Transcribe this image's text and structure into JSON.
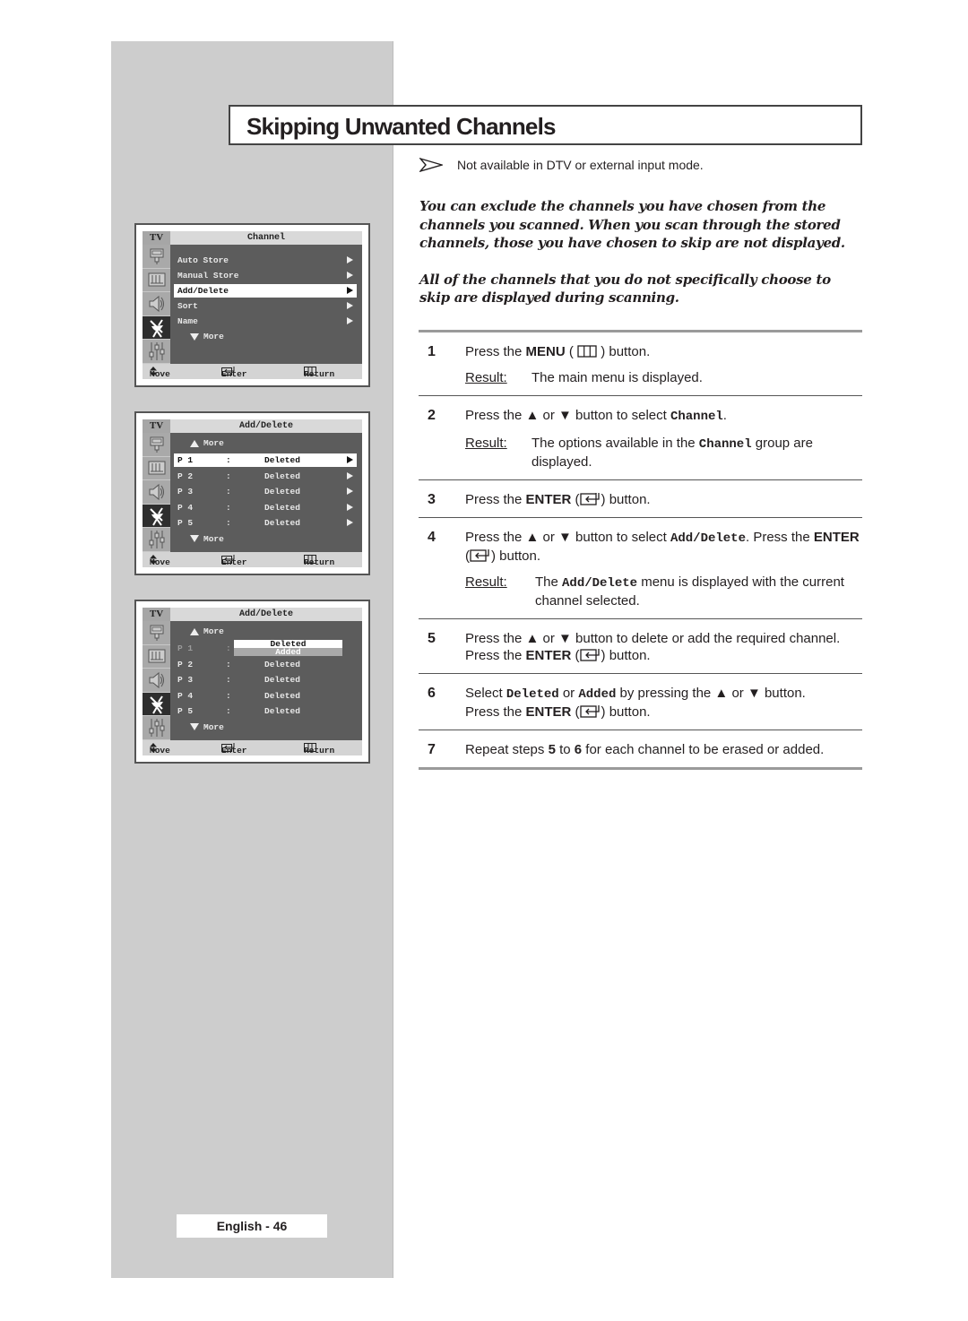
{
  "page": {
    "title": "Skipping Unwanted Channels",
    "note": "Not available in DTV or external input mode.",
    "note_icon": "arrow-pointer-icon",
    "intro": [
      "You can exclude the channels you have chosen from the channels you scanned. When you scan through the stored channels, those you have chosen to skip are not displayed.",
      "All of the channels that you do not specifically choose to skip are displayed during scanning."
    ],
    "page_number": "English - 46"
  },
  "steps": [
    {
      "num": "1",
      "parts": {
        "a": "Press the ",
        "b": "MENU",
        "c": " ( ",
        "d": " )  button."
      },
      "result_label": "Result:",
      "result": "The main menu is displayed."
    },
    {
      "num": "2",
      "parts": {
        "a": "Press the ▲ or ▼ button to select ",
        "mono": "Channel",
        "c": "."
      },
      "result_label": "Result:",
      "result_a": "The options available in the ",
      "result_mono": "Channel",
      "result_b": " group are displayed."
    },
    {
      "num": "3",
      "parts": {
        "a": "Press the ",
        "b": "ENTER",
        "c": " (",
        "d": ") button."
      }
    },
    {
      "num": "4",
      "parts": {
        "a": "Press the ▲ or ▼ button to select ",
        "mono": "Add/Delete",
        "c": ". Press the ",
        "b": "ENTER",
        "d": "(",
        "e": ") button."
      },
      "result_label": "Result:",
      "result_a": "The ",
      "result_mono": "Add/Delete",
      "result_b": " menu is displayed with the current channel selected."
    },
    {
      "num": "5",
      "parts": {
        "a": "Press the ▲ or ▼ button to delete or add the required channel.",
        "b1": "Press the ",
        "b": "ENTER",
        "c": " (",
        "d": ") button."
      }
    },
    {
      "num": "6",
      "parts": {
        "a": "Select ",
        "mono1": "Deleted",
        "c": " or ",
        "mono2": "Added",
        "d": "  by pressing the ▲ or ▼ button.",
        "b1": "Press the ",
        "b": "ENTER",
        "e": " (",
        "f": ") button."
      }
    },
    {
      "num": "7",
      "parts": {
        "a": "Repeat steps ",
        "b": "5",
        "c": " to ",
        "d": "6",
        "e": " for each channel to be erased or added."
      }
    }
  ],
  "osd_common": {
    "tv_label": "TV",
    "icons": [
      "input-icon",
      "picture-icon",
      "sound-icon",
      "channel-antenna-icon",
      "setup-equalizer-icon"
    ],
    "active_icon": "channel-antenna-icon",
    "footer": {
      "move": "Move",
      "enter": "Enter",
      "return": "Return"
    },
    "more": "More"
  },
  "osd1": {
    "header": "Channel",
    "items": [
      {
        "label": "Auto Store",
        "selected": false
      },
      {
        "label": "Manual Store",
        "selected": false
      },
      {
        "label": "Add/Delete",
        "selected": true
      },
      {
        "label": "Sort",
        "selected": false
      },
      {
        "label": "Name",
        "selected": false
      }
    ]
  },
  "osd2": {
    "header": "Add/Delete",
    "rows": [
      {
        "prog": "P 1",
        "sep": ":",
        "status": "Deleted",
        "selected": true
      },
      {
        "prog": "P 2",
        "sep": ":",
        "status": "Deleted"
      },
      {
        "prog": "P 3",
        "sep": ":",
        "status": "Deleted"
      },
      {
        "prog": "P 4",
        "sep": ":",
        "status": "Deleted"
      },
      {
        "prog": "P 5",
        "sep": ":",
        "status": "Deleted"
      }
    ]
  },
  "osd3": {
    "header": "Add/Delete",
    "rows": [
      {
        "prog": "P 1",
        "sep": ":",
        "status": ""
      },
      {
        "prog": "P 2",
        "sep": ":",
        "status": "Deleted"
      },
      {
        "prog": "P 3",
        "sep": ":",
        "status": "Deleted"
      },
      {
        "prog": "P 4",
        "sep": ":",
        "status": "Deleted"
      },
      {
        "prog": "P 5",
        "sep": ":",
        "status": "Deleted"
      }
    ],
    "popup_options": [
      "Deleted",
      "Added"
    ],
    "popup_selected": "Deleted"
  }
}
